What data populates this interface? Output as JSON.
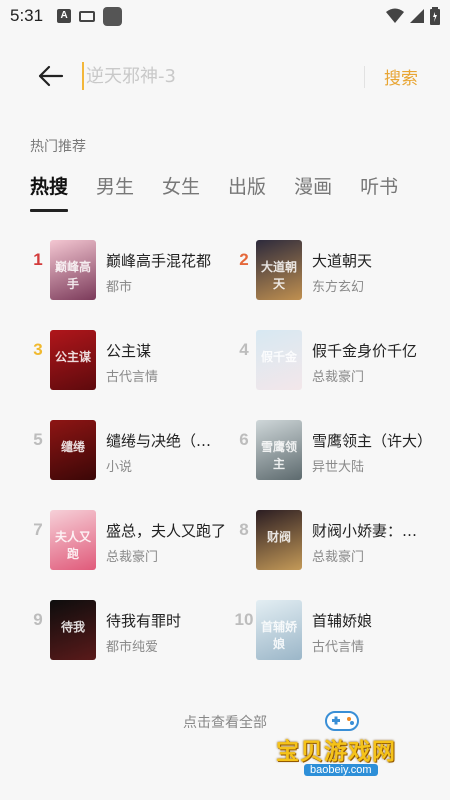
{
  "status_bar": {
    "time": "5:31"
  },
  "search": {
    "placeholder": "逆天邪神-3",
    "value": "",
    "button_label": "搜索"
  },
  "section": {
    "title": "热门推荐"
  },
  "tabs": [
    {
      "label": "热搜",
      "active": true
    },
    {
      "label": "男生",
      "active": false
    },
    {
      "label": "女生",
      "active": false
    },
    {
      "label": "出版",
      "active": false
    },
    {
      "label": "漫画",
      "active": false
    },
    {
      "label": "听书",
      "active": false
    }
  ],
  "books": [
    {
      "rank": "1",
      "title": "巅峰高手混花都",
      "genre": "都市",
      "rank_color": "#d33b3b",
      "cover_colors": [
        "#f4c7d2",
        "#7b3a5a"
      ],
      "cover_text": "巅峰高手"
    },
    {
      "rank": "2",
      "title": "大道朝天",
      "genre": "东方玄幻",
      "rank_color": "#e5683a",
      "cover_colors": [
        "#2d2a3c",
        "#c09050"
      ],
      "cover_text": "大道朝天"
    },
    {
      "rank": "3",
      "title": "公主谋",
      "genre": "古代言情",
      "rank_color": "#f0b92f",
      "cover_colors": [
        "#b0161b",
        "#5e0a0d"
      ],
      "cover_text": "公主谋"
    },
    {
      "rank": "4",
      "title": "假千金身价千亿",
      "genre": "总裁豪门",
      "rank_color": "#bdbdbd",
      "cover_colors": [
        "#d7e8f2",
        "#f3e7ea"
      ],
      "cover_text": "假千金"
    },
    {
      "rank": "5",
      "title": "缱绻与决绝（完整版）",
      "genre": "小说",
      "rank_color": "#bdbdbd",
      "cover_colors": [
        "#8e1514",
        "#3b0707"
      ],
      "cover_text": "缱绻"
    },
    {
      "rank": "6",
      "title": "雪鹰领主（许大）",
      "genre": "异世大陆",
      "rank_color": "#bdbdbd",
      "cover_colors": [
        "#cfd7d9",
        "#5d6a6e"
      ],
      "cover_text": "雪鹰领主"
    },
    {
      "rank": "7",
      "title": "盛总，夫人又跑了",
      "genre": "总裁豪门",
      "rank_color": "#bdbdbd",
      "cover_colors": [
        "#f6d0d8",
        "#e05a7a"
      ],
      "cover_text": "夫人又跑"
    },
    {
      "rank": "8",
      "title": "财阀小娇妻：乖乖宠",
      "genre": "总裁豪门",
      "rank_color": "#bdbdbd",
      "cover_colors": [
        "#2b1d22",
        "#c49a58"
      ],
      "cover_text": "财阀"
    },
    {
      "rank": "9",
      "title": "待我有罪时",
      "genre": "都市纯爱",
      "rank_color": "#bdbdbd",
      "cover_colors": [
        "#0d0d0d",
        "#5a1a1a"
      ],
      "cover_text": "待我"
    },
    {
      "rank": "10",
      "title": "首辅娇娘",
      "genre": "古代言情",
      "rank_color": "#bdbdbd",
      "cover_colors": [
        "#e3eef3",
        "#9bb6c8"
      ],
      "cover_text": "首辅娇娘"
    }
  ],
  "footer": {
    "view_all": "点击查看全部"
  },
  "watermark": {
    "title": "宝贝游戏网",
    "url": "baobeiy.com"
  }
}
